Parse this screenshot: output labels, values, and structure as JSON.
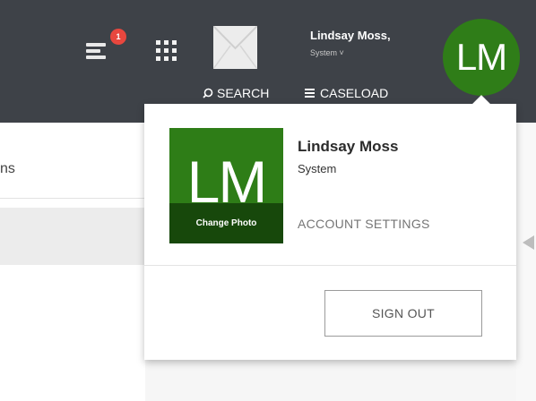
{
  "header": {
    "notification_count": "1",
    "user_name": "Lindsay Moss,",
    "user_role": "System ˅",
    "avatar_initials": "LM",
    "nav": {
      "search_icon": "search-icon",
      "search_label": "SEARCH",
      "caseload_icon": "menu-icon",
      "caseload_label": "CASELOAD"
    },
    "icons": [
      "notifications-icon",
      "apps-grid-icon",
      "mail-icon"
    ]
  },
  "background": {
    "tab_label": "ns"
  },
  "dropdown": {
    "photo_initials": "LM",
    "change_photo_label": "Change Photo",
    "name": "Lindsay Moss",
    "role": "System",
    "account_settings_label": "ACCOUNT SETTINGS",
    "sign_out_label": "SIGN OUT"
  },
  "colors": {
    "topbar": "#3e4248",
    "avatar_green": "#2f7d18",
    "badge_red": "#e8473e"
  }
}
